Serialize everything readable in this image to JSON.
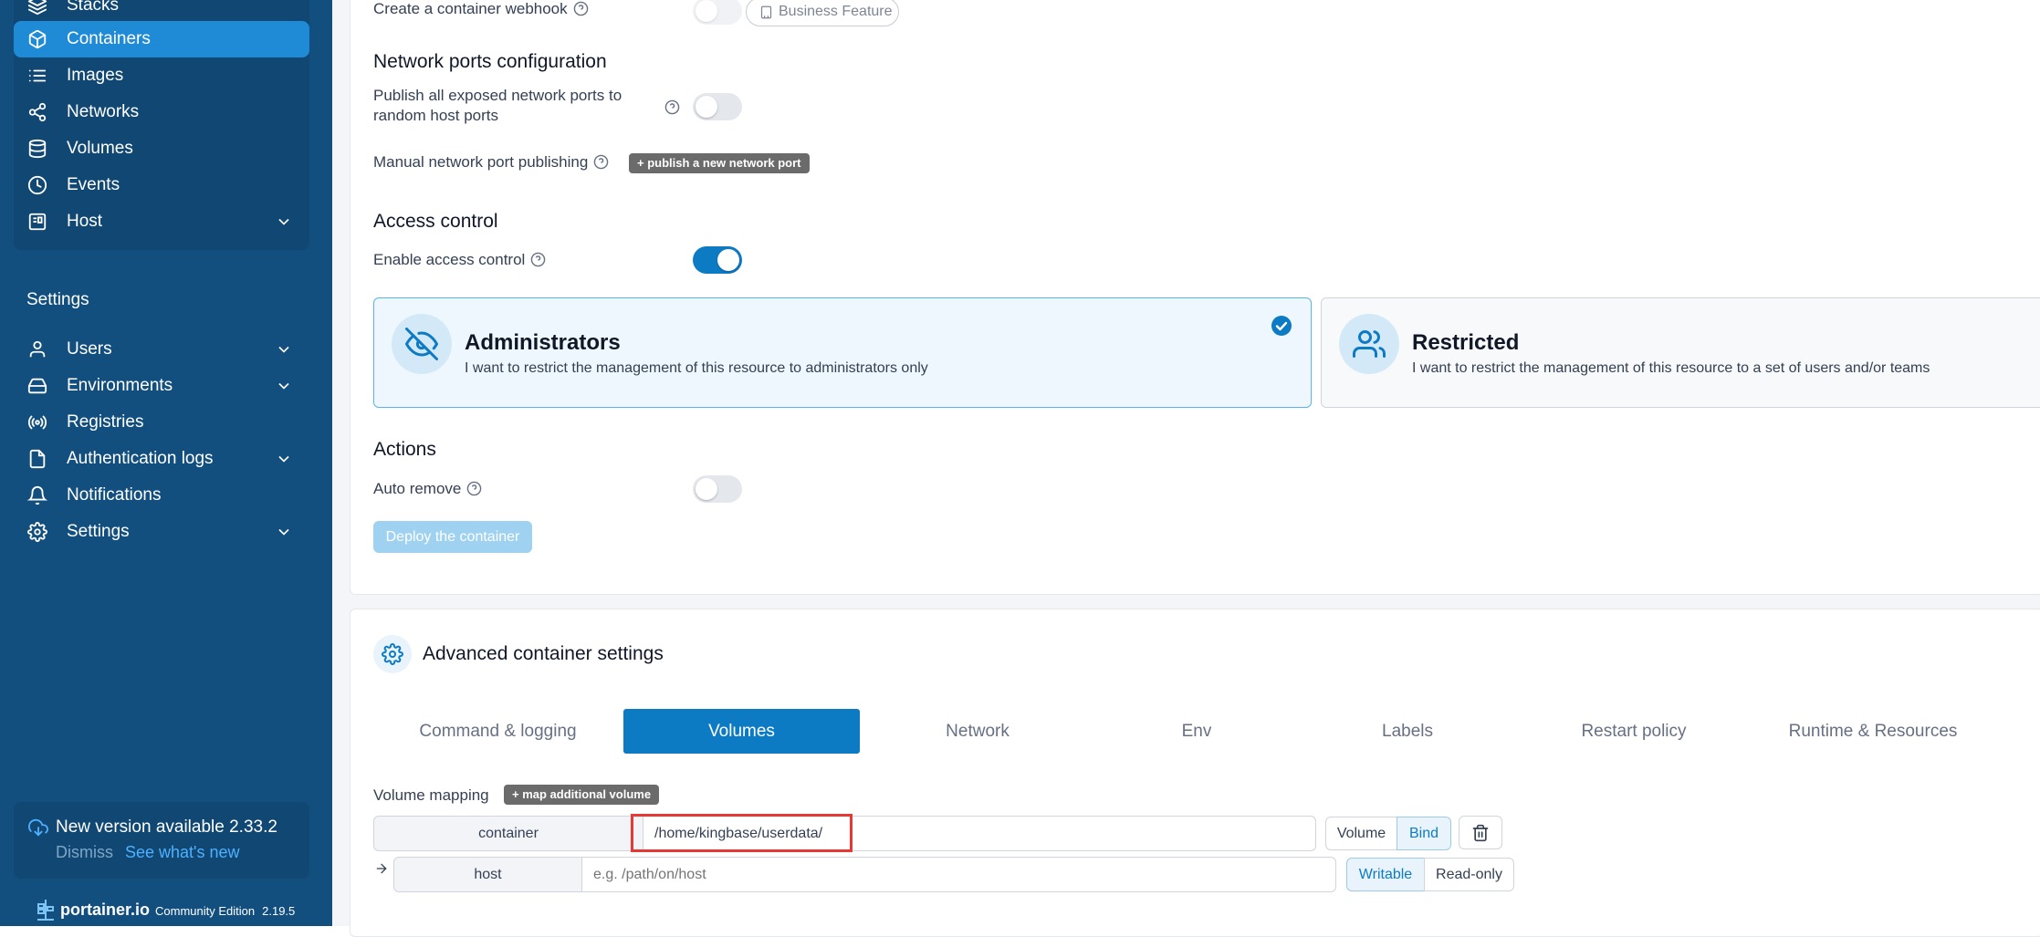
{
  "sidebar": {
    "items": [
      {
        "label": "Stacks",
        "icon": "stacks-icon"
      },
      {
        "label": "Containers",
        "icon": "box-icon",
        "active": true
      },
      {
        "label": "Images",
        "icon": "list-icon"
      },
      {
        "label": "Networks",
        "icon": "share-icon"
      },
      {
        "label": "Volumes",
        "icon": "database-icon"
      },
      {
        "label": "Events",
        "icon": "clock-icon"
      },
      {
        "label": "Host",
        "icon": "server-icon",
        "expandable": true
      }
    ],
    "settings_heading": "Settings",
    "settings_items": [
      {
        "label": "Users",
        "icon": "user-icon",
        "expandable": true
      },
      {
        "label": "Environments",
        "icon": "hard-drive-icon",
        "expandable": true
      },
      {
        "label": "Registries",
        "icon": "radio-icon"
      },
      {
        "label": "Authentication logs",
        "icon": "file-icon",
        "expandable": true
      },
      {
        "label": "Notifications",
        "icon": "bell-icon"
      },
      {
        "label": "Settings",
        "icon": "gear-icon",
        "expandable": true
      }
    ],
    "update": {
      "title": "New version available 2.33.2",
      "dismiss": "Dismiss",
      "link": "See what's new"
    },
    "brand": {
      "name": "portainer.io",
      "edition": "Community Edition",
      "version": "2.19.5"
    }
  },
  "form": {
    "webhook": {
      "label": "Create a container webhook",
      "enabled": false,
      "badge": "Business Feature"
    },
    "network_ports": {
      "heading": "Network ports configuration",
      "publish_all_label_line1": "Publish all exposed network ports to",
      "publish_all_label_line2": "random host ports",
      "publish_all": false,
      "manual_label": "Manual network port publishing",
      "manual_button": "+ publish a new network port"
    },
    "access_control": {
      "heading": "Access control",
      "enable_label": "Enable access control",
      "enabled": true,
      "options": [
        {
          "title": "Administrators",
          "description": "I want to restrict the management of this resource to administrators only",
          "selected": true,
          "icon": "eye-off-icon"
        },
        {
          "title": "Restricted",
          "description": "I want to restrict the management of this resource to a set of users and/or teams",
          "selected": false,
          "icon": "users-icon"
        }
      ]
    },
    "actions": {
      "heading": "Actions",
      "auto_remove_label": "Auto remove",
      "auto_remove": false,
      "deploy_button": "Deploy the container"
    }
  },
  "advanced": {
    "heading": "Advanced container settings",
    "tabs": [
      {
        "label": "Command & logging"
      },
      {
        "label": "Volumes",
        "active": true
      },
      {
        "label": "Network"
      },
      {
        "label": "Env"
      },
      {
        "label": "Labels"
      },
      {
        "label": "Restart policy"
      },
      {
        "label": "Runtime & Resources"
      }
    ],
    "volume_mapping": {
      "label": "Volume mapping",
      "add_button": "+ map additional volume",
      "container_addon": "container",
      "container_value": "/home/kingbase/userdata/",
      "type_options": [
        "Volume",
        "Bind"
      ],
      "type_selected": "Bind",
      "host_addon": "host",
      "host_placeholder": "e.g. /path/on/host",
      "host_value": "",
      "mode_options": [
        "Writable",
        "Read-only"
      ],
      "mode_selected": "Writable"
    }
  },
  "colors": {
    "sidebar_bg": "#124f7f",
    "active_item": "#1f8ad6",
    "primary": "#0d7bc4",
    "highlight_border": "#e53935"
  }
}
